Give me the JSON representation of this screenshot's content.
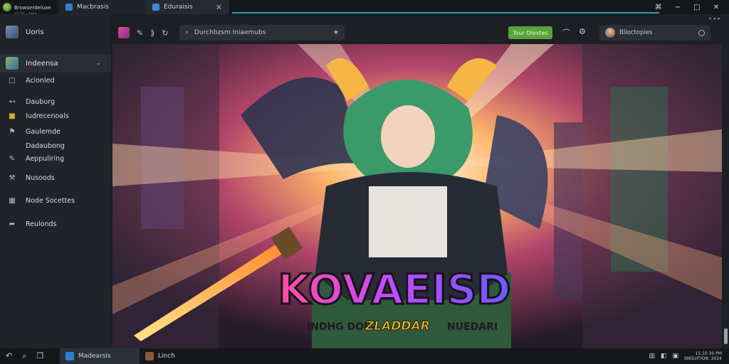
{
  "titlebar": {
    "app_name": "Browserdeluxe",
    "app_subtitle": "v3.16 -- beta",
    "tabs": [
      {
        "label": "Macbrasis",
        "icon": "window-icon"
      },
      {
        "label": "Eduraisis",
        "icon": "window-icon"
      }
    ],
    "window_controls": {
      "minimize": "−",
      "maximize": "□",
      "close": "✕"
    },
    "extra_icon": "⌘",
    "sys_status": "⨯ ▸ ▸"
  },
  "sidebar": {
    "header": "Uoris",
    "selector": "Indeensa",
    "items": [
      {
        "label": "Acionled",
        "icon": "□"
      },
      {
        "label": "Dauburg",
        "icon": "↤"
      },
      {
        "label": "Iudrecenoals",
        "icon": "■"
      },
      {
        "label": "Gaulemde",
        "icon": "⚑"
      },
      {
        "label": "Dadaubong",
        "icon": ""
      },
      {
        "label": "Aeppuliring",
        "icon": "✎"
      },
      {
        "label": "Nusoods",
        "icon": "⚒"
      },
      {
        "label": "Node Socettes",
        "icon": "▦"
      },
      {
        "label": "Reulonds",
        "icon": "➦"
      }
    ]
  },
  "toolbar": {
    "url": "Durchbzsm Iniaemubs",
    "sign_label": "Tour Dlextes",
    "profile_name": "Blioctopies"
  },
  "hero": {
    "title": "KOVAEISD",
    "subtitle_left": "INDHG DOR-",
    "subtitle_highlight": "ZLADDAR",
    "subtitle_right": "NUEDARI"
  },
  "taskbar": {
    "apps": [
      {
        "label": "Madearsis"
      },
      {
        "label": "Linch"
      }
    ],
    "clock_time": "15 10 30 PM",
    "clock_date": "SNGUITION: 2024"
  }
}
